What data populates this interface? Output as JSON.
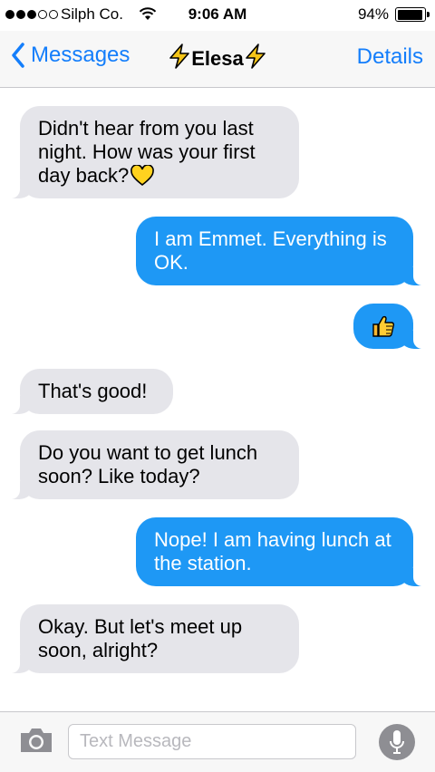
{
  "status_bar": {
    "carrier": "Silph Co.",
    "time": "9:06 AM",
    "battery_percent": "94%",
    "battery_level": 0.94,
    "signal_bars_filled": 3,
    "signal_bars_total": 5
  },
  "nav_bar": {
    "back_label": "Messages",
    "contact_name": "Elesa",
    "details_label": "Details",
    "accent_color": "#147efb"
  },
  "messages": [
    {
      "direction": "incoming",
      "text": "Didn't hear from you last night. How was your first day back?",
      "emoji": "yellow-heart"
    },
    {
      "direction": "outgoing",
      "text": "I am Emmet. Everything is OK."
    },
    {
      "direction": "outgoing",
      "text": "",
      "emoji": "thumbs-up"
    },
    {
      "direction": "incoming",
      "text": "That's good!"
    },
    {
      "direction": "incoming",
      "text": "Do you want to get lunch soon? Like today?"
    },
    {
      "direction": "outgoing",
      "text": "Nope! I am having lunch at the station."
    },
    {
      "direction": "incoming",
      "text": "Okay. But let's meet up soon, alright?"
    }
  ],
  "input_bar": {
    "placeholder": "Text Message",
    "value": ""
  },
  "colors": {
    "incoming_bubble": "#e5e5ea",
    "outgoing_bubble": "#1e98f5",
    "bolt": "#f5c518"
  }
}
